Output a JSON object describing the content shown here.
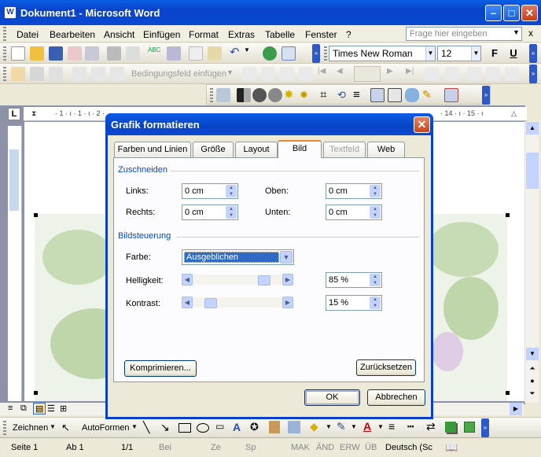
{
  "window": {
    "title": "Dokument1 - Microsoft Word",
    "app_icon": "W"
  },
  "menubar": {
    "items": [
      {
        "label": "Datei"
      },
      {
        "label": "Bearbeiten"
      },
      {
        "label": "Ansicht"
      },
      {
        "label": "Einfügen"
      },
      {
        "label": "Format"
      },
      {
        "label": "Extras"
      },
      {
        "label": "Tabelle"
      },
      {
        "label": "Fenster"
      },
      {
        "label": "?"
      }
    ],
    "search_placeholder": "Frage hier eingeben",
    "close_glyph": "x"
  },
  "formatting": {
    "font": "Times New Roman",
    "size": "12",
    "bold": "F",
    "underline": "U"
  },
  "mailmerge": {
    "field_label": "Bedingungsfeld einfügen"
  },
  "ruler": {
    "left_marks": "· 1 · ı · 1 · ı · 2 ·",
    "right_marks": "· 14 · ı · 15 · ı"
  },
  "drawing": {
    "zeichnen": "Zeichnen",
    "autoformen": "AutoFormen"
  },
  "status": {
    "page": "Seite 1",
    "section": "Ab 1",
    "pages": "1/1",
    "at": "Bei",
    "line": "Ze",
    "col": "Sp",
    "mak": "MAK",
    "and": "ÄND",
    "erw": "ERW",
    "ub": "ÜB",
    "lang": "Deutsch (Sc"
  },
  "dialog": {
    "title": "Grafik formatieren",
    "tabs": [
      {
        "label": "Farben und Linien"
      },
      {
        "label": "Größe"
      },
      {
        "label": "Layout"
      },
      {
        "label": "Bild"
      },
      {
        "label": "Textfeld"
      },
      {
        "label": "Web"
      }
    ],
    "crop": {
      "heading": "Zuschneiden",
      "left_label": "Links:",
      "left_value": "0 cm",
      "top_label": "Oben:",
      "top_value": "0 cm",
      "right_label": "Rechts:",
      "right_value": "0 cm",
      "bottom_label": "Unten:",
      "bottom_value": "0 cm"
    },
    "image_control": {
      "heading": "Bildsteuerung",
      "color_label": "Farbe:",
      "color_value": "Ausgeblichen",
      "brightness_label": "Helligkeit:",
      "brightness_value": "85 %",
      "brightness_level": 0.85,
      "contrast_label": "Kontrast:",
      "contrast_value": "15 %",
      "contrast_level": 0.15
    },
    "compress_label": "Komprimieren...",
    "reset_label": "Zurücksetzen",
    "ok_label": "OK",
    "cancel_label": "Abbrechen"
  }
}
